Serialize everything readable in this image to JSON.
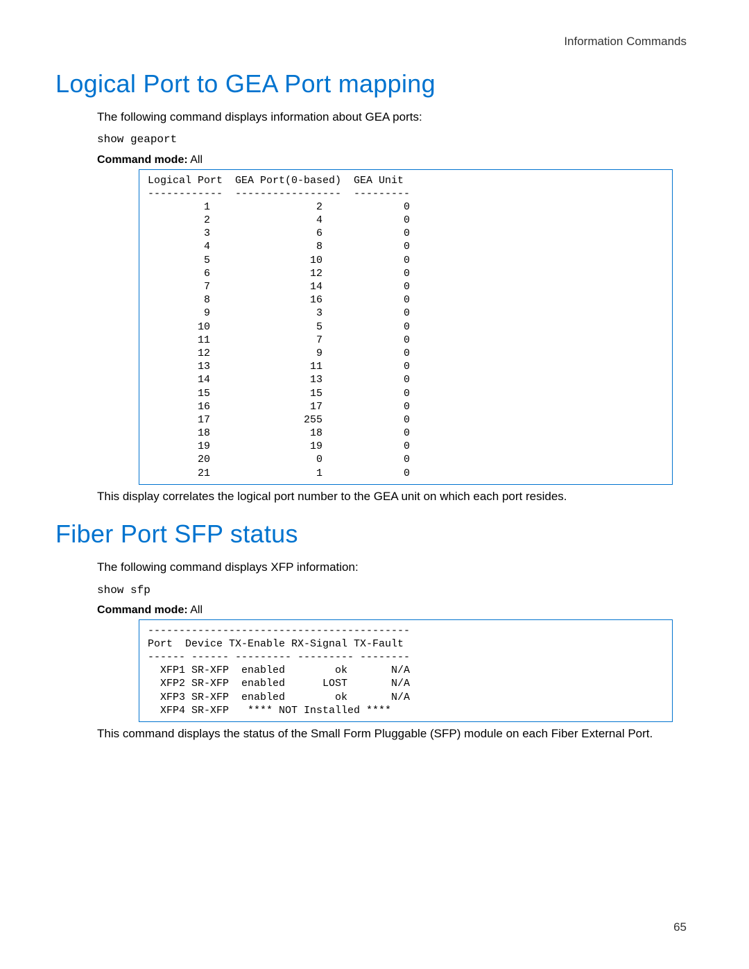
{
  "header": {
    "right": "Information Commands"
  },
  "sections": {
    "gea": {
      "title": "Logical Port to GEA Port mapping",
      "intro": "The following command displays information about GEA ports:",
      "command": "show geaport",
      "mode_label": "Command mode:",
      "mode_value": " All",
      "footer": "This display correlates the logical port number to the GEA unit on which each port resides."
    },
    "sfp": {
      "title": "Fiber Port SFP status",
      "intro": "The following command displays XFP information:",
      "command": "show sfp",
      "mode_label": "Command mode:",
      "mode_value": " All",
      "footer": "This command displays the status of the Small Form Pluggable (SFP) module on each Fiber External Port."
    }
  },
  "chart_data": [
    {
      "type": "table",
      "title": "GEA Port mapping output",
      "columns": [
        "Logical Port",
        "GEA Port(0-based)",
        "GEA Unit"
      ],
      "rows": [
        [
          1,
          2,
          0
        ],
        [
          2,
          4,
          0
        ],
        [
          3,
          6,
          0
        ],
        [
          4,
          8,
          0
        ],
        [
          5,
          10,
          0
        ],
        [
          6,
          12,
          0
        ],
        [
          7,
          14,
          0
        ],
        [
          8,
          16,
          0
        ],
        [
          9,
          3,
          0
        ],
        [
          10,
          5,
          0
        ],
        [
          11,
          7,
          0
        ],
        [
          12,
          9,
          0
        ],
        [
          13,
          11,
          0
        ],
        [
          14,
          13,
          0
        ],
        [
          15,
          15,
          0
        ],
        [
          16,
          17,
          0
        ],
        [
          17,
          255,
          0
        ],
        [
          18,
          18,
          0
        ],
        [
          19,
          19,
          0
        ],
        [
          20,
          0,
          0
        ],
        [
          21,
          1,
          0
        ]
      ]
    },
    {
      "type": "table",
      "title": "SFP status output",
      "columns": [
        "Port",
        "Device",
        "TX-Enable",
        "RX-Signal",
        "TX-Fault"
      ],
      "rows": [
        [
          "XFP1",
          "SR-XFP",
          "enabled",
          "ok",
          "N/A"
        ],
        [
          "XFP2",
          "SR-XFP",
          "enabled",
          "LOST",
          "N/A"
        ],
        [
          "XFP3",
          "SR-XFP",
          "enabled",
          "ok",
          "N/A"
        ],
        [
          "XFP4",
          "SR-XFP",
          "**** NOT Installed ****",
          "",
          ""
        ]
      ]
    }
  ],
  "page_number": "65"
}
